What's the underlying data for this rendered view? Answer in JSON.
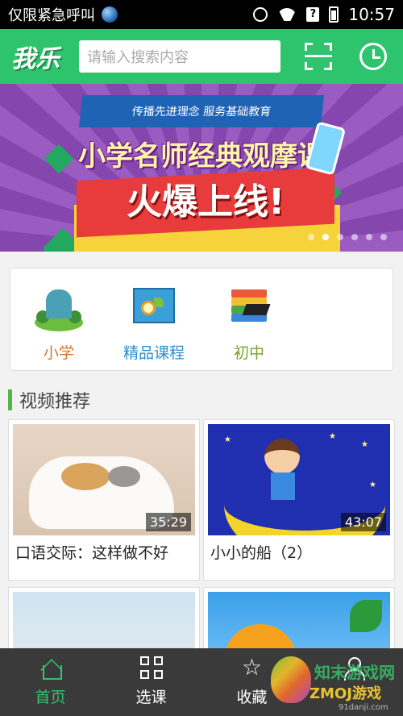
{
  "status_bar": {
    "carrier": "仅限紧急呼叫",
    "time": "10:57",
    "signal_label": "?"
  },
  "header": {
    "logo": "我乐",
    "search_placeholder": "请输入搜索内容"
  },
  "banner": {
    "ribbon": "传播先进理念  服务基础教育",
    "headline": "小学名师经典观摩课",
    "subline": "火爆上线!",
    "slide_count": 6,
    "active_slide": 2
  },
  "categories": [
    {
      "label": "小学",
      "color": "#d4742f"
    },
    {
      "label": "精品课程",
      "color": "#2b8fcf"
    },
    {
      "label": "初中",
      "color": "#7aa227"
    }
  ],
  "section": {
    "title": "视频推荐"
  },
  "videos": [
    {
      "title": "口语交际：这样做不好",
      "duration": "35:29"
    },
    {
      "title": "小小的船（2）",
      "duration": "43:07"
    },
    {
      "title": "",
      "duration": ""
    },
    {
      "title": "",
      "duration": ""
    }
  ],
  "bottom_nav": [
    {
      "label": "首页",
      "icon": "home-icon",
      "active": true
    },
    {
      "label": "选课",
      "icon": "grid-icon",
      "active": false
    },
    {
      "label": "收藏",
      "icon": "star-icon",
      "active": false
    },
    {
      "label": "",
      "icon": "user-icon",
      "active": false
    }
  ],
  "watermark": {
    "line1": "知末游戏网",
    "line2": "ZMOJ游戏",
    "line3": "91danji.com"
  },
  "colors": {
    "brand_green": "#2ec46d",
    "nav_bg": "#3a3a3a",
    "active_tab": "#36c26c"
  }
}
